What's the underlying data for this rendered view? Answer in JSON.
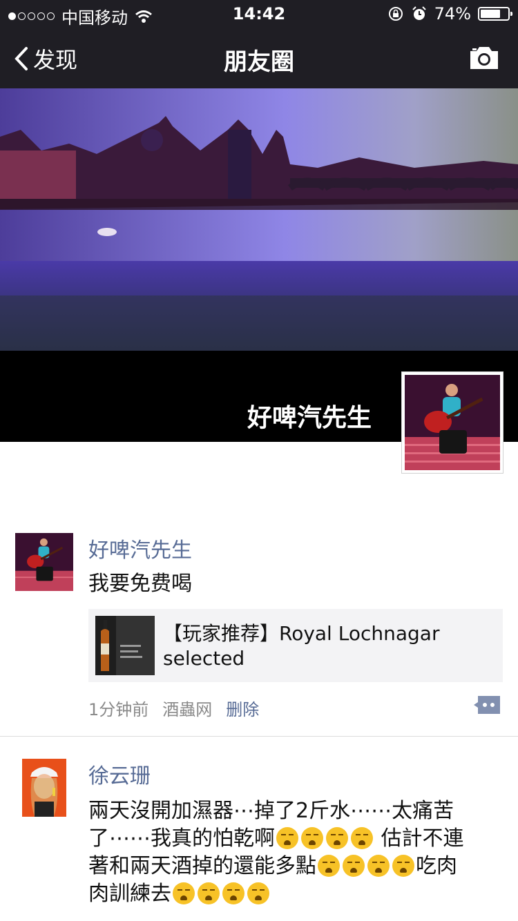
{
  "status_bar": {
    "carrier": "中国移动",
    "time": "14:42",
    "battery": "74%",
    "battery_level": 0.74
  },
  "nav": {
    "back_label": "发现",
    "title": "朋友圈"
  },
  "cover": {
    "user_name": "好啤汽先生"
  },
  "posts": [
    {
      "name": "好啤汽先生",
      "text": "我要免费喝",
      "link_title": "【玩家推荐】Royal Lochnagar selected",
      "time": "1分钟前",
      "source": "酒蟲网",
      "delete_label": "删除"
    },
    {
      "name": "徐云珊",
      "text_lines": [
        "兩天沒開加濕器⋯掉了2斤水⋯⋯太痛苦",
        "了⋯⋯我真的怕乾啊",
        "估計不連",
        "著和兩天酒掉的還能多點",
        "吃肉",
        "肉訓練去"
      ]
    }
  ],
  "icons": {
    "back": "chevron-left-icon",
    "camera": "camera-icon",
    "comment": "comment-icon",
    "emoji": "crying-emoji-icon"
  }
}
